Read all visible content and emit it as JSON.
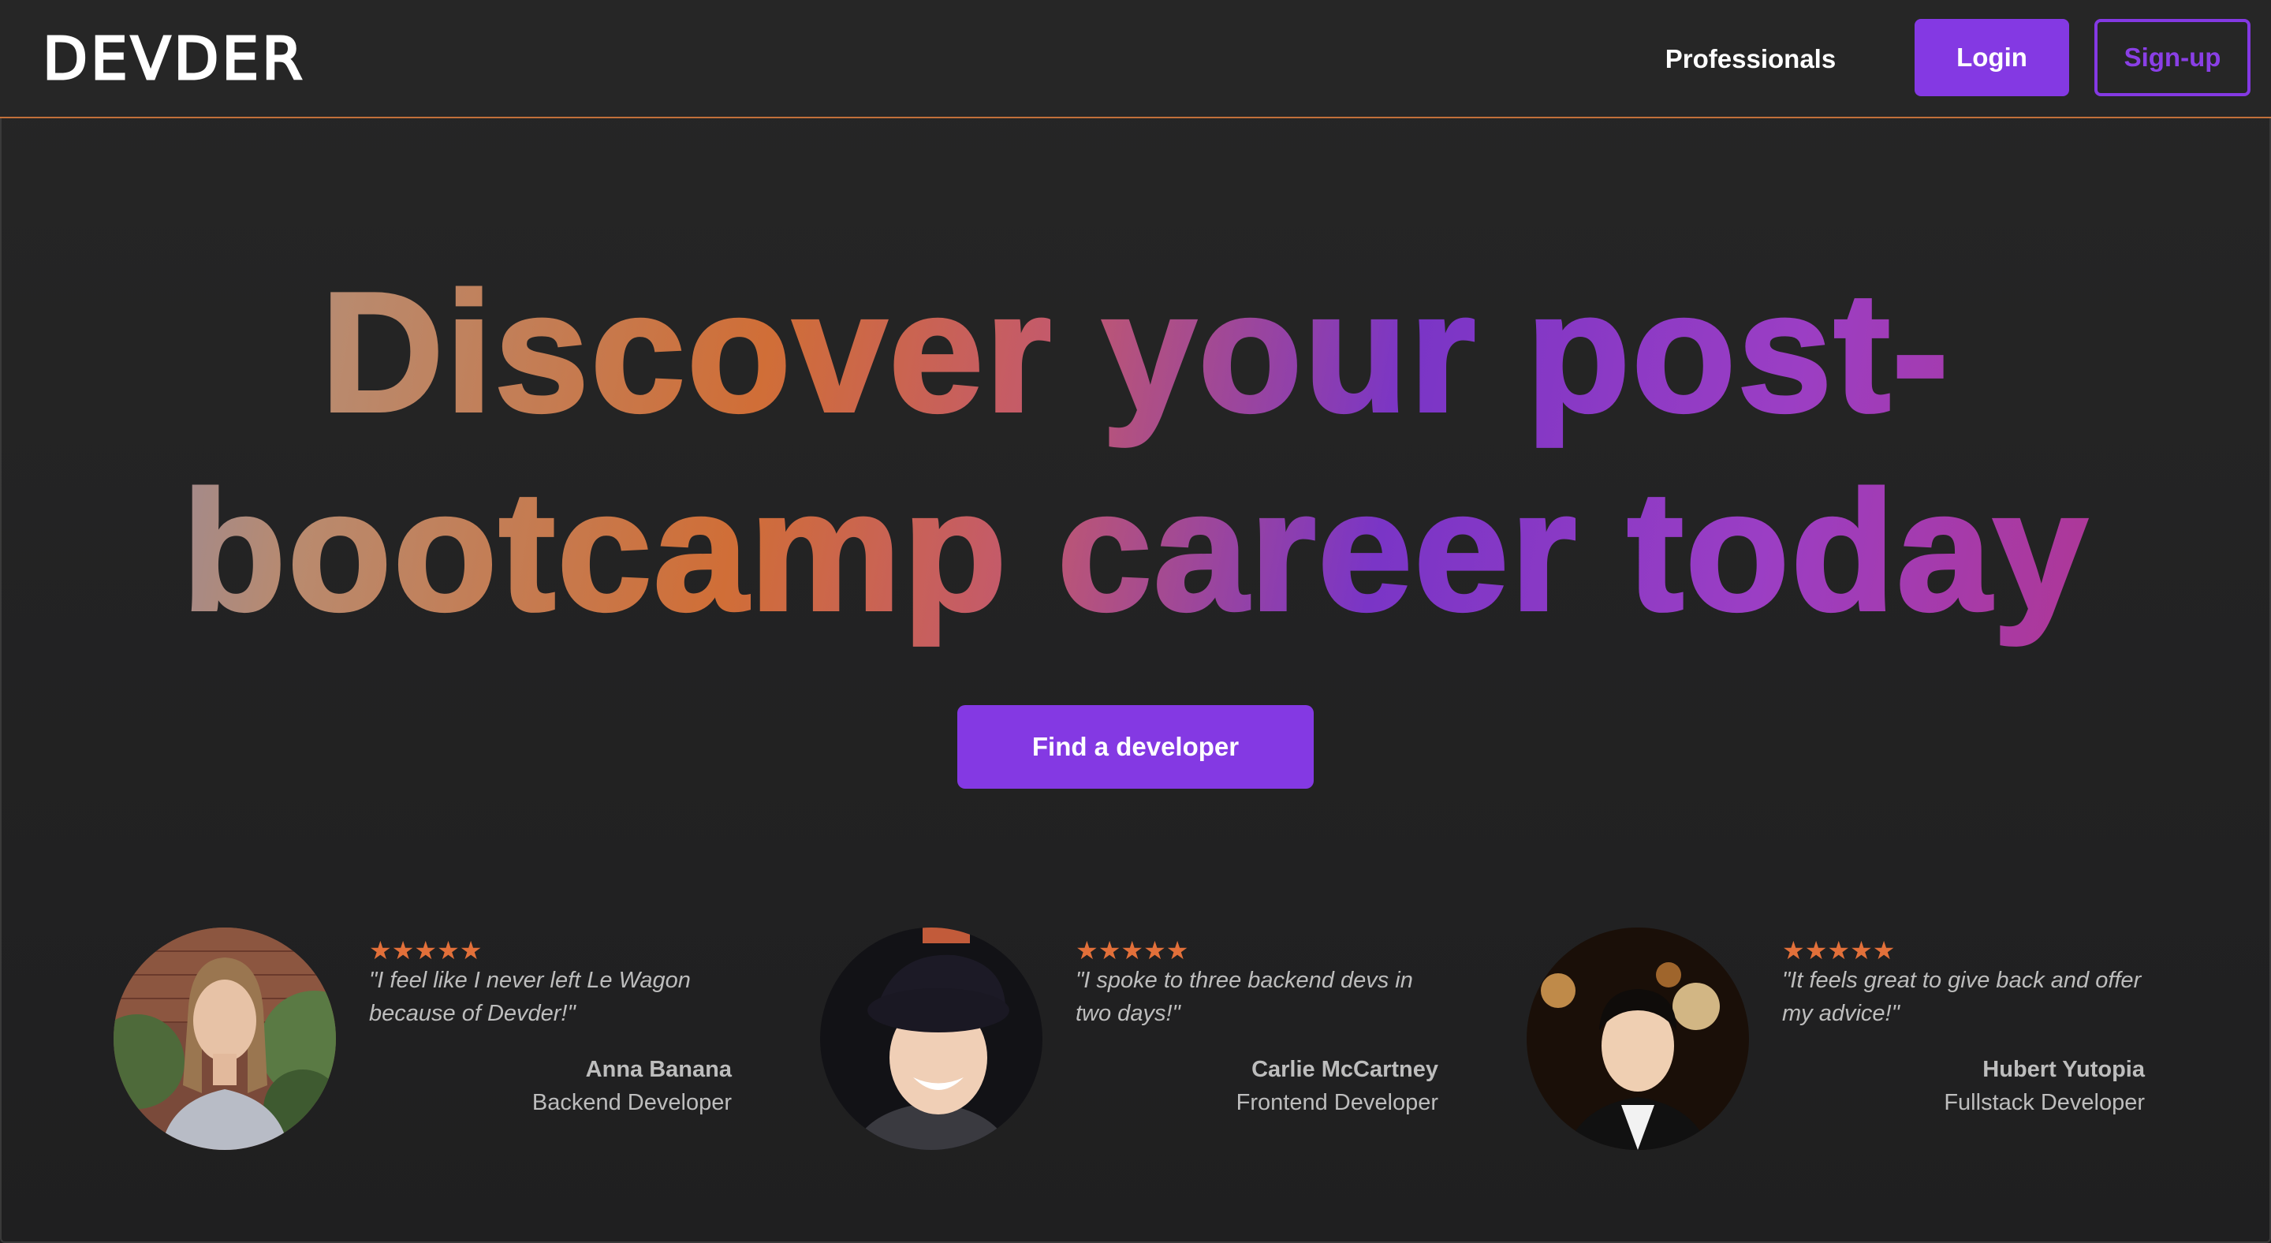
{
  "nav": {
    "logo": "DEVDER",
    "professionals": "Professionals",
    "login": "Login",
    "signup": "Sign-up"
  },
  "hero": {
    "line1": "Discover your post-",
    "line2": "bootcamp career today",
    "cta": "Find a developer"
  },
  "testimonials": [
    {
      "stars": "★★★★★",
      "rating": 5,
      "quote": "\"I feel like I never left Le Wagon because of Devder!\"",
      "name": "Anna Banana",
      "role": "Backend Developer"
    },
    {
      "stars": "★★★★★",
      "rating": 5,
      "quote": "\"I spoke to three backend devs in two days!\"",
      "name": "Carlie McCartney",
      "role": "Frontend Developer"
    },
    {
      "stars": "★★★★★",
      "rating": 5,
      "quote": "\"It feels great to give back and offer my advice!\"",
      "name": "Hubert Yutopia",
      "role": "Fullstack Developer"
    }
  ],
  "colors": {
    "accent": "#8439e3",
    "star": "#e2703a",
    "nav_border": "#c2703a",
    "background": "#232323"
  }
}
